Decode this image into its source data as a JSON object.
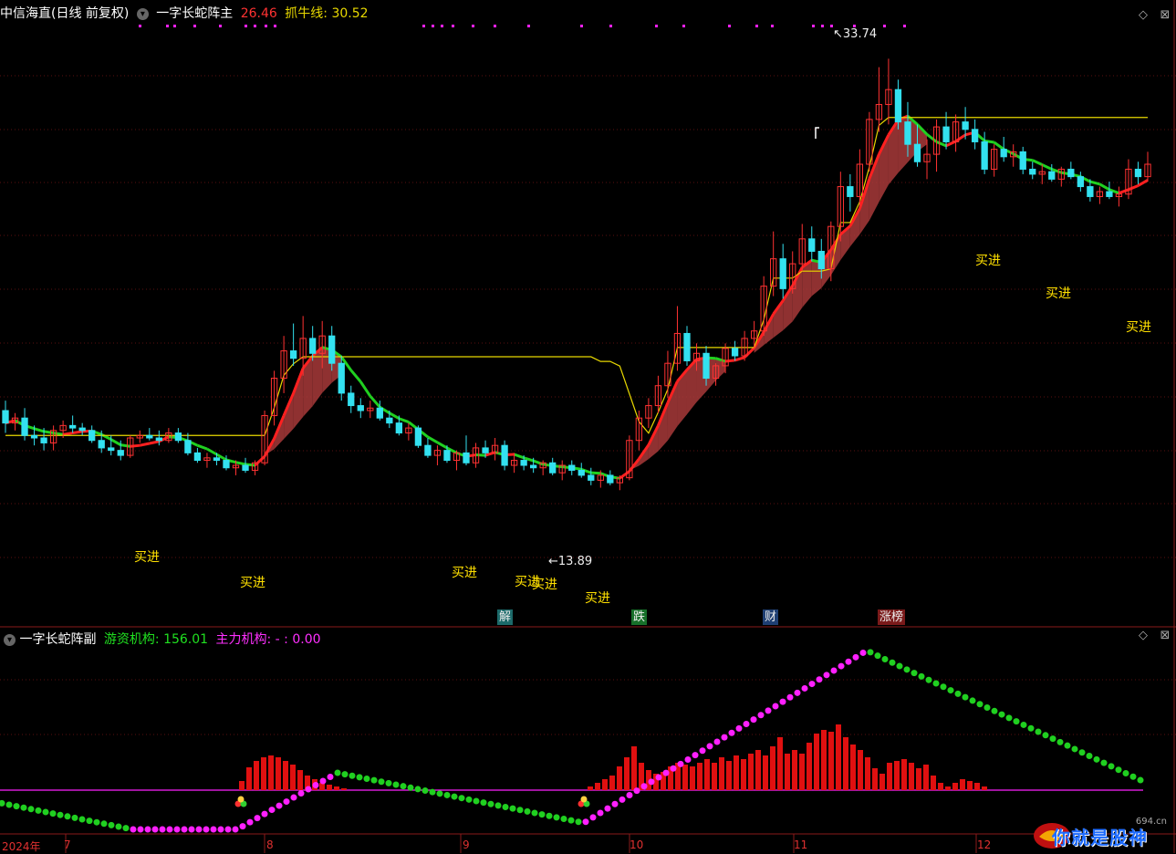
{
  "main": {
    "stock_name": "中信海直(日线 前复权)",
    "indicator_name": "一字长蛇阵主",
    "first_value": "26.46",
    "zhuaniu_label": "抓牛线: 30.52",
    "high_marker": "33.74",
    "low_marker": "13.89",
    "buy_label": "买进",
    "event_tags": [
      "解",
      "跌",
      "财",
      "涨榜"
    ]
  },
  "sub": {
    "indicator_name": "一字长蛇阵副",
    "youzi_label": "游资机构: 156.01",
    "zhuli_label": "主力机构: - : 0.00"
  },
  "x_axis": {
    "labels": [
      "2024年",
      "7",
      "8",
      "9",
      "10",
      "11",
      "12"
    ]
  },
  "watermark": {
    "text": "你就是股神",
    "site": "694.cn"
  },
  "colors": {
    "up": "#ff3232",
    "down": "#33e1f0",
    "ma_green": "#20d020",
    "ma_red": "#ff2020",
    "yellow": "#e8d800",
    "magenta": "#ff20ff"
  },
  "chart_data": {
    "type": "candlestick",
    "candles": [
      [
        19.6,
        20.0,
        18.7,
        19.1
      ],
      [
        19.1,
        19.5,
        18.8,
        19.3
      ],
      [
        19.3,
        19.7,
        18.4,
        18.6
      ],
      [
        18.6,
        19.0,
        18.2,
        18.5
      ],
      [
        18.5,
        18.9,
        18.0,
        18.3
      ],
      [
        18.3,
        19.0,
        18.0,
        18.8
      ],
      [
        18.8,
        19.2,
        18.5,
        19.0
      ],
      [
        19.0,
        19.4,
        18.7,
        18.9
      ],
      [
        18.9,
        19.1,
        18.6,
        18.8
      ],
      [
        18.8,
        19.0,
        18.3,
        18.4
      ],
      [
        18.4,
        18.8,
        17.9,
        18.1
      ],
      [
        18.1,
        18.6,
        17.8,
        18.0
      ],
      [
        18.0,
        18.4,
        17.6,
        17.8
      ],
      [
        17.8,
        18.6,
        17.7,
        18.5
      ],
      [
        18.5,
        18.8,
        18.3,
        18.6
      ],
      [
        18.6,
        18.9,
        18.4,
        18.5
      ],
      [
        18.5,
        18.8,
        18.2,
        18.4
      ],
      [
        18.4,
        18.9,
        18.3,
        18.7
      ],
      [
        18.7,
        18.9,
        18.3,
        18.4
      ],
      [
        18.4,
        18.7,
        17.8,
        17.9
      ],
      [
        17.9,
        18.1,
        17.5,
        17.6
      ],
      [
        17.6,
        17.9,
        17.3,
        17.7
      ],
      [
        17.7,
        17.9,
        17.4,
        17.6
      ],
      [
        17.6,
        17.8,
        17.2,
        17.3
      ],
      [
        17.3,
        17.6,
        17.0,
        17.4
      ],
      [
        17.4,
        17.7,
        17.1,
        17.2
      ],
      [
        17.2,
        17.6,
        17.0,
        17.5
      ],
      [
        17.5,
        19.6,
        17.4,
        19.4
      ],
      [
        19.4,
        21.2,
        19.0,
        20.9
      ],
      [
        20.9,
        22.6,
        20.3,
        22.0
      ],
      [
        22.0,
        23.1,
        21.4,
        21.7
      ],
      [
        21.7,
        23.4,
        21.0,
        22.5
      ],
      [
        22.5,
        23.0,
        21.6,
        21.9
      ],
      [
        21.9,
        23.2,
        21.3,
        22.6
      ],
      [
        22.6,
        23.0,
        21.2,
        21.5
      ],
      [
        21.5,
        21.8,
        20.0,
        20.3
      ],
      [
        20.3,
        20.6,
        19.5,
        19.8
      ],
      [
        19.8,
        20.1,
        19.3,
        19.6
      ],
      [
        19.6,
        20.0,
        19.3,
        19.7
      ],
      [
        19.7,
        20.0,
        19.2,
        19.3
      ],
      [
        19.3,
        19.6,
        18.9,
        19.1
      ],
      [
        19.1,
        19.4,
        18.6,
        18.7
      ],
      [
        18.7,
        19.1,
        18.4,
        18.9
      ],
      [
        18.9,
        19.0,
        18.1,
        18.2
      ],
      [
        18.2,
        18.5,
        17.7,
        17.8
      ],
      [
        17.8,
        18.2,
        17.4,
        18.0
      ],
      [
        18.0,
        18.2,
        17.5,
        17.6
      ],
      [
        17.6,
        18.0,
        17.2,
        17.9
      ],
      [
        17.9,
        18.6,
        17.4,
        17.5
      ],
      [
        17.5,
        18.3,
        17.3,
        18.1
      ],
      [
        18.1,
        18.4,
        17.7,
        17.9
      ],
      [
        17.9,
        18.5,
        17.6,
        18.2
      ],
      [
        18.2,
        18.4,
        17.2,
        17.4
      ],
      [
        17.4,
        17.9,
        17.1,
        17.6
      ],
      [
        17.6,
        17.8,
        17.2,
        17.4
      ],
      [
        17.4,
        17.7,
        17.1,
        17.3
      ],
      [
        17.3,
        17.6,
        17.0,
        17.5
      ],
      [
        17.5,
        17.7,
        17.0,
        17.1
      ],
      [
        17.1,
        17.6,
        16.8,
        17.4
      ],
      [
        17.4,
        17.6,
        17.0,
        17.2
      ],
      [
        17.2,
        17.5,
        16.9,
        17.0
      ],
      [
        17.0,
        17.3,
        16.6,
        16.8
      ],
      [
        16.8,
        17.2,
        16.5,
        17.0
      ],
      [
        17.0,
        17.2,
        16.6,
        16.7
      ],
      [
        16.7,
        17.0,
        16.4,
        16.9
      ],
      [
        16.9,
        18.6,
        16.8,
        18.4
      ],
      [
        18.4,
        19.6,
        18.0,
        19.3
      ],
      [
        19.3,
        20.1,
        18.9,
        19.8
      ],
      [
        19.8,
        21.0,
        19.5,
        20.6
      ],
      [
        20.6,
        22.0,
        20.1,
        21.5
      ],
      [
        21.5,
        23.8,
        21.2,
        22.7
      ],
      [
        22.7,
        23.0,
        21.4,
        21.6
      ],
      [
        21.6,
        22.3,
        21.2,
        21.9
      ],
      [
        21.9,
        22.2,
        20.6,
        20.9
      ],
      [
        20.9,
        21.5,
        20.6,
        21.4
      ],
      [
        21.4,
        22.3,
        21.1,
        22.1
      ],
      [
        22.1,
        22.4,
        21.6,
        21.8
      ],
      [
        21.8,
        22.8,
        21.6,
        22.5
      ],
      [
        22.5,
        23.2,
        22.1,
        22.8
      ],
      [
        22.8,
        25.0,
        22.6,
        24.6
      ],
      [
        24.6,
        26.8,
        24.2,
        25.7
      ],
      [
        25.7,
        26.3,
        24.1,
        24.5
      ],
      [
        24.5,
        26.0,
        24.3,
        25.5
      ],
      [
        25.5,
        27.1,
        25.2,
        26.5
      ],
      [
        26.5,
        27.0,
        25.6,
        26.0
      ],
      [
        26.0,
        26.5,
        24.9,
        25.3
      ],
      [
        25.3,
        27.2,
        24.8,
        27.0
      ],
      [
        27.0,
        29.2,
        26.4,
        28.6
      ],
      [
        28.6,
        29.1,
        27.6,
        28.2
      ],
      [
        28.2,
        30.1,
        27.8,
        29.5
      ],
      [
        29.5,
        31.6,
        29.2,
        31.3
      ],
      [
        31.3,
        33.4,
        30.8,
        31.9
      ],
      [
        31.9,
        33.74,
        31.1,
        32.5
      ],
      [
        32.5,
        32.9,
        30.9,
        31.2
      ],
      [
        31.2,
        32.0,
        29.8,
        30.3
      ],
      [
        30.3,
        31.1,
        29.4,
        29.6
      ],
      [
        29.6,
        30.5,
        28.9,
        29.9
      ],
      [
        29.9,
        31.3,
        29.2,
        31.0
      ],
      [
        31.0,
        31.6,
        30.1,
        30.4
      ],
      [
        30.4,
        31.5,
        30.0,
        31.2
      ],
      [
        31.2,
        31.8,
        30.5,
        30.9
      ],
      [
        30.9,
        31.3,
        30.1,
        30.4
      ],
      [
        30.4,
        30.8,
        29.1,
        29.3
      ],
      [
        29.3,
        30.3,
        29.0,
        30.1
      ],
      [
        30.1,
        30.6,
        29.6,
        29.8
      ],
      [
        29.8,
        30.3,
        29.4,
        30.0
      ],
      [
        30.0,
        30.2,
        29.1,
        29.3
      ],
      [
        29.3,
        29.6,
        28.9,
        29.1
      ],
      [
        29.1,
        29.5,
        28.7,
        29.2
      ],
      [
        29.2,
        29.5,
        28.8,
        28.9
      ],
      [
        28.9,
        29.4,
        28.6,
        29.3
      ],
      [
        29.3,
        29.6,
        28.9,
        29.0
      ],
      [
        29.0,
        29.2,
        28.4,
        28.6
      ],
      [
        28.6,
        28.9,
        28.0,
        28.2
      ],
      [
        28.2,
        28.6,
        27.9,
        28.4
      ],
      [
        28.4,
        28.8,
        28.1,
        28.2
      ],
      [
        28.2,
        28.6,
        27.8,
        28.3
      ],
      [
        28.3,
        29.7,
        28.1,
        29.3
      ],
      [
        29.3,
        29.6,
        28.7,
        29.0
      ],
      [
        29.0,
        30.0,
        28.8,
        29.5
      ]
    ]
  }
}
